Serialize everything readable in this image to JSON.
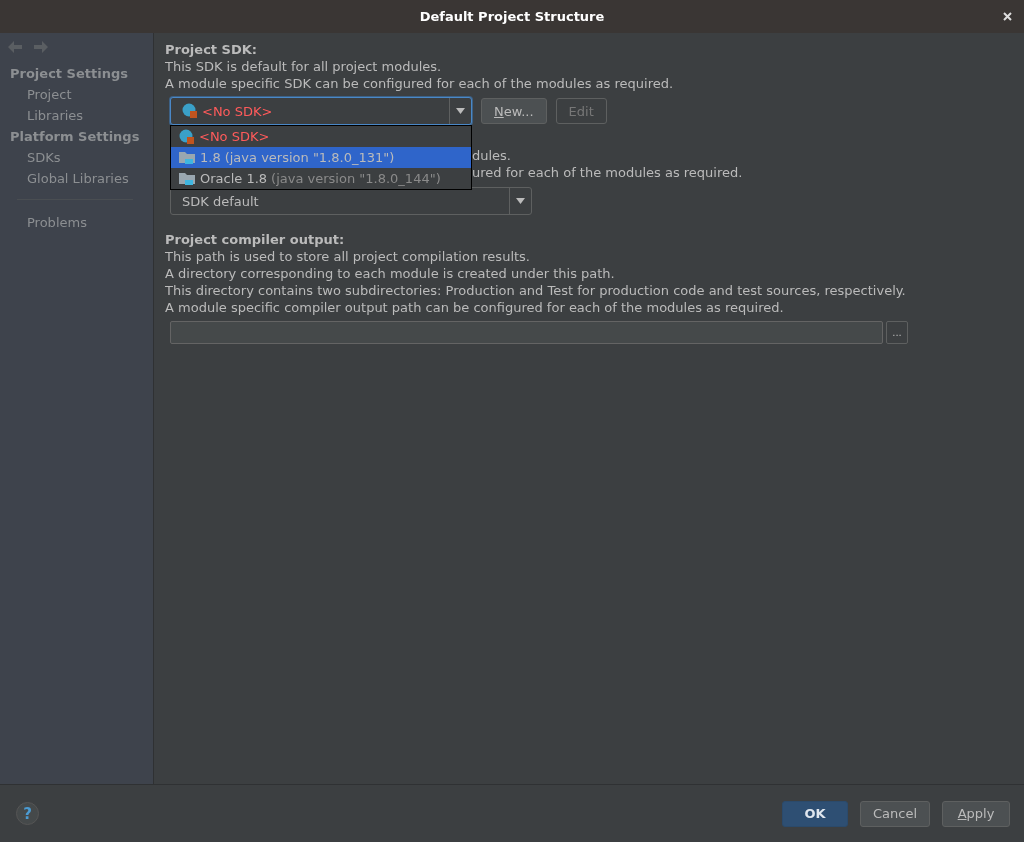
{
  "window": {
    "title": "Default Project Structure"
  },
  "sidebar": {
    "groups": [
      {
        "title": "Project Settings",
        "items": [
          {
            "label": "Project",
            "selected": false
          },
          {
            "label": "Libraries",
            "selected": false
          }
        ]
      },
      {
        "title": "Platform Settings",
        "items": [
          {
            "label": "SDKs",
            "selected": false
          },
          {
            "label": "Global Libraries",
            "selected": false
          }
        ]
      }
    ],
    "bottom_items": [
      {
        "label": "Problems",
        "selected": false
      }
    ]
  },
  "project_sdk": {
    "heading": "Project SDK:",
    "lines": [
      "This SDK is default for all project modules.",
      "A module specific SDK can be configured for each of the modules as required."
    ],
    "combo": {
      "value": "<No SDK>",
      "expanded": true
    },
    "buttons": [
      {
        "label": "New...",
        "mnemonic": true,
        "disabled": false
      },
      {
        "label": "Edit",
        "disabled": true
      }
    ],
    "options": [
      {
        "kind": "none",
        "name": "<No SDK>",
        "selected": false
      },
      {
        "kind": "jdk",
        "name": "1.8",
        "detail": "(java version \"1.8.0_131\")",
        "selected": true
      },
      {
        "kind": "jdk",
        "name": "Oracle 1.8",
        "detail": "(java version \"1.8.0_144\")",
        "selected": false
      }
    ]
  },
  "language_level": {
    "lines": [
      "dules.",
      "ured for each of the modules as required."
    ],
    "combo": {
      "value": "SDK default"
    }
  },
  "compiler_output": {
    "heading": "Project compiler output:",
    "lines": [
      "This path is used to store all project compilation results.",
      "A directory corresponding to each module is created under this path.",
      "This directory contains two subdirectories: Production and Test for production code and test sources, respectively.",
      "A module specific compiler output path can be configured for each of the modules as required."
    ],
    "browse": "..."
  },
  "footer": {
    "help": "?",
    "buttons": [
      {
        "label": "OK",
        "default": true
      },
      {
        "label": "Cancel",
        "default": false
      },
      {
        "label": "Apply",
        "default": false,
        "mnemonic": true
      }
    ]
  }
}
